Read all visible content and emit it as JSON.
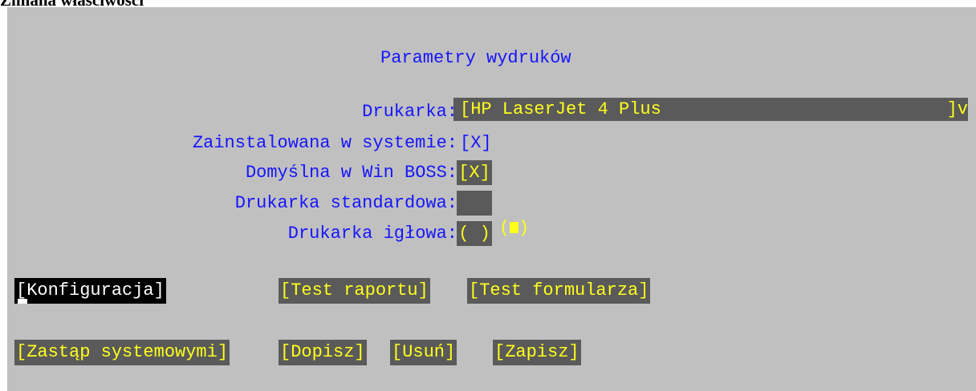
{
  "window_title": "Zmiana właściwości",
  "dialog": {
    "heading": "Parametry wydruków",
    "fields": {
      "printer_label": "Drukarka:",
      "printer_value": "[HP LaserJet 4 Plus",
      "printer_dropdown": "]v",
      "installed_label": "Zainstalowana w systemie:",
      "installed_value": "[X]",
      "default_label": "Domyślna w Win BOSS:",
      "default_value": "[X]",
      "standard_label": "Drukarka standardowa:",
      "standard_open": "(",
      "standard_close": ")",
      "standard_selected": true,
      "needle_label": "Drukarka igłowa:",
      "needle_value": "( )"
    },
    "buttons": {
      "configuration": "[Konfiguracja]",
      "test_report": "[Test raportu]",
      "test_form": "[Test formularza]",
      "replace_system": "[Zastąp systemowymi]",
      "add": "[Dopisz]",
      "delete": "[Usuń]",
      "save": "[Zapisz]"
    }
  },
  "colors": {
    "background": "#c0c0c0",
    "label_text": "#1515ff",
    "field_bg": "#5a5a5a",
    "field_text": "#ffff1c",
    "focused_bg": "#000000",
    "focused_text": "#ffffff"
  }
}
